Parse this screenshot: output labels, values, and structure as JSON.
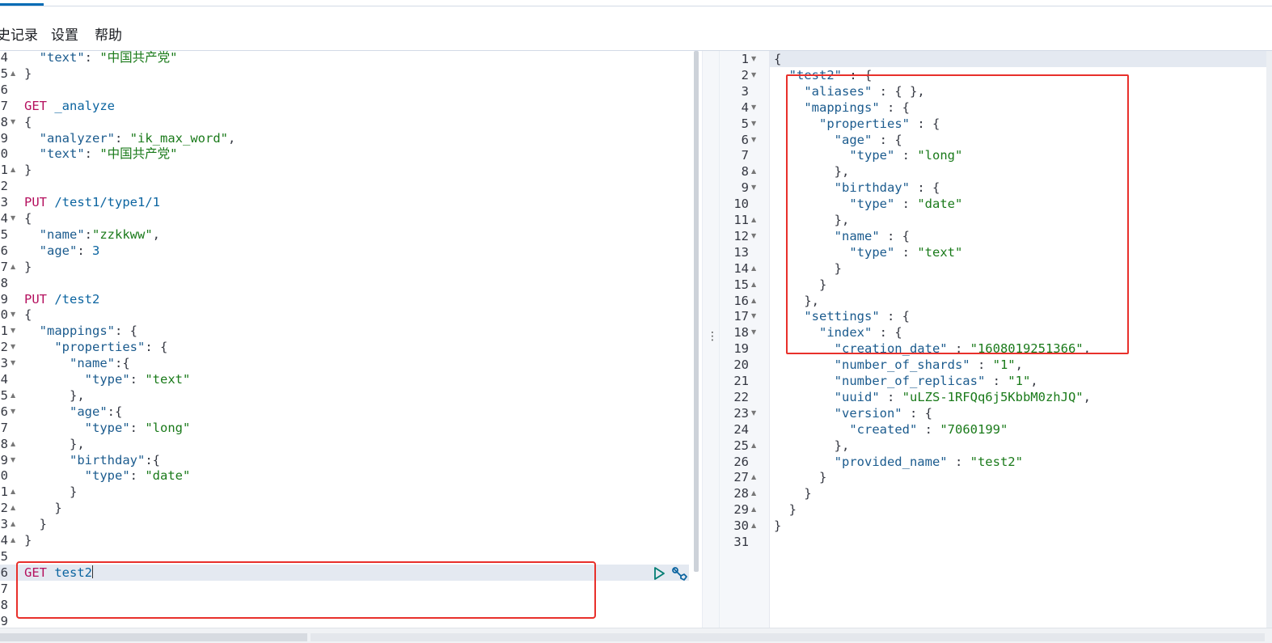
{
  "menu": {
    "items": [
      "史记录",
      "设置",
      "帮助"
    ]
  },
  "colors": {
    "method": "#b5115f",
    "string": "#1a7a1a",
    "key": "#1b5b8e",
    "highlight_box": "#e8302b"
  },
  "left_editor": {
    "lines": [
      {
        "num": "4",
        "fold": "",
        "parts": [
          [
            "p",
            "  "
          ],
          [
            "k",
            "\"text\""
          ],
          [
            "p",
            ": "
          ],
          [
            "s",
            "\"中国共产党\""
          ]
        ]
      },
      {
        "num": "5",
        "fold": "up",
        "parts": [
          [
            "p",
            "}"
          ]
        ]
      },
      {
        "num": "6",
        "fold": "",
        "parts": []
      },
      {
        "num": "7",
        "fold": "",
        "parts": [
          [
            "m",
            "GET"
          ],
          [
            "p",
            " "
          ],
          [
            "n",
            "_analyze"
          ]
        ]
      },
      {
        "num": "8",
        "fold": "down",
        "parts": [
          [
            "p",
            "{"
          ]
        ]
      },
      {
        "num": "9",
        "fold": "",
        "parts": [
          [
            "p",
            "  "
          ],
          [
            "k",
            "\"analyzer\""
          ],
          [
            "p",
            ": "
          ],
          [
            "s",
            "\"ik_max_word\""
          ],
          [
            "p",
            ","
          ]
        ]
      },
      {
        "num": "0",
        "fold": "",
        "parts": [
          [
            "p",
            "  "
          ],
          [
            "k",
            "\"text\""
          ],
          [
            "p",
            ": "
          ],
          [
            "s",
            "\"中国共产党\""
          ]
        ]
      },
      {
        "num": "1",
        "fold": "up",
        "parts": [
          [
            "p",
            "}"
          ]
        ]
      },
      {
        "num": "2",
        "fold": "",
        "parts": []
      },
      {
        "num": "3",
        "fold": "",
        "parts": [
          [
            "m",
            "PUT"
          ],
          [
            "p",
            " "
          ],
          [
            "n",
            "/test1/type1/1"
          ]
        ]
      },
      {
        "num": "4",
        "fold": "down",
        "parts": [
          [
            "p",
            "{"
          ]
        ]
      },
      {
        "num": "5",
        "fold": "",
        "parts": [
          [
            "p",
            "  "
          ],
          [
            "k",
            "\"name\""
          ],
          [
            "p",
            ":"
          ],
          [
            "s",
            "\"zzkkww\""
          ],
          [
            "p",
            ","
          ]
        ]
      },
      {
        "num": "6",
        "fold": "",
        "parts": [
          [
            "p",
            "  "
          ],
          [
            "k",
            "\"age\""
          ],
          [
            "p",
            ": "
          ],
          [
            "n",
            "3"
          ]
        ]
      },
      {
        "num": "7",
        "fold": "up",
        "parts": [
          [
            "p",
            "}"
          ]
        ]
      },
      {
        "num": "8",
        "fold": "",
        "parts": []
      },
      {
        "num": "9",
        "fold": "",
        "parts": [
          [
            "m",
            "PUT"
          ],
          [
            "p",
            " "
          ],
          [
            "n",
            "/test2"
          ]
        ]
      },
      {
        "num": "0",
        "fold": "down",
        "parts": [
          [
            "p",
            "{"
          ]
        ]
      },
      {
        "num": "1",
        "fold": "down",
        "parts": [
          [
            "p",
            "  "
          ],
          [
            "k",
            "\"mappings\""
          ],
          [
            "p",
            ": {"
          ]
        ]
      },
      {
        "num": "2",
        "fold": "down",
        "parts": [
          [
            "p",
            "    "
          ],
          [
            "k",
            "\"properties\""
          ],
          [
            "p",
            ": {"
          ]
        ]
      },
      {
        "num": "3",
        "fold": "down",
        "parts": [
          [
            "p",
            "      "
          ],
          [
            "k",
            "\"name\""
          ],
          [
            "p",
            ":{"
          ]
        ]
      },
      {
        "num": "4",
        "fold": "",
        "parts": [
          [
            "p",
            "        "
          ],
          [
            "k",
            "\"type\""
          ],
          [
            "p",
            ": "
          ],
          [
            "s",
            "\"text\""
          ]
        ]
      },
      {
        "num": "5",
        "fold": "up",
        "parts": [
          [
            "p",
            "      },"
          ]
        ]
      },
      {
        "num": "6",
        "fold": "down",
        "parts": [
          [
            "p",
            "      "
          ],
          [
            "k",
            "\"age\""
          ],
          [
            "p",
            ":{"
          ]
        ]
      },
      {
        "num": "7",
        "fold": "",
        "parts": [
          [
            "p",
            "        "
          ],
          [
            "k",
            "\"type\""
          ],
          [
            "p",
            ": "
          ],
          [
            "s",
            "\"long\""
          ]
        ]
      },
      {
        "num": "8",
        "fold": "up",
        "parts": [
          [
            "p",
            "      },"
          ]
        ]
      },
      {
        "num": "9",
        "fold": "down",
        "parts": [
          [
            "p",
            "      "
          ],
          [
            "k",
            "\"birthday\""
          ],
          [
            "p",
            ":{"
          ]
        ]
      },
      {
        "num": "0",
        "fold": "",
        "parts": [
          [
            "p",
            "        "
          ],
          [
            "k",
            "\"type\""
          ],
          [
            "p",
            ": "
          ],
          [
            "s",
            "\"date\""
          ]
        ]
      },
      {
        "num": "1",
        "fold": "up",
        "parts": [
          [
            "p",
            "      }"
          ]
        ]
      },
      {
        "num": "2",
        "fold": "up",
        "parts": [
          [
            "p",
            "    }"
          ]
        ]
      },
      {
        "num": "3",
        "fold": "up",
        "parts": [
          [
            "p",
            "  }"
          ]
        ]
      },
      {
        "num": "4",
        "fold": "up",
        "parts": [
          [
            "p",
            "}"
          ]
        ]
      },
      {
        "num": "5",
        "fold": "",
        "parts": []
      },
      {
        "num": "6",
        "fold": "",
        "parts": [
          [
            "m",
            "GET"
          ],
          [
            "p",
            " "
          ],
          [
            "n",
            "test2"
          ]
        ],
        "active": true
      },
      {
        "num": "7",
        "fold": "",
        "parts": []
      },
      {
        "num": "8",
        "fold": "",
        "parts": []
      },
      {
        "num": "9",
        "fold": "",
        "parts": []
      }
    ]
  },
  "right_output": {
    "lines": [
      {
        "num": "1",
        "fold": "down",
        "parts": [
          [
            "p",
            "{"
          ]
        ],
        "active": true
      },
      {
        "num": "2",
        "fold": "down",
        "parts": [
          [
            "p",
            "  "
          ],
          [
            "k",
            "\"test2\""
          ],
          [
            "p",
            " : {"
          ]
        ]
      },
      {
        "num": "3",
        "fold": "",
        "parts": [
          [
            "p",
            "    "
          ],
          [
            "k",
            "\"aliases\""
          ],
          [
            "p",
            " : { },"
          ]
        ]
      },
      {
        "num": "4",
        "fold": "down",
        "parts": [
          [
            "p",
            "    "
          ],
          [
            "k",
            "\"mappings\""
          ],
          [
            "p",
            " : {"
          ]
        ]
      },
      {
        "num": "5",
        "fold": "down",
        "parts": [
          [
            "p",
            "      "
          ],
          [
            "k",
            "\"properties\""
          ],
          [
            "p",
            " : {"
          ]
        ]
      },
      {
        "num": "6",
        "fold": "down",
        "parts": [
          [
            "p",
            "        "
          ],
          [
            "k",
            "\"age\""
          ],
          [
            "p",
            " : {"
          ]
        ]
      },
      {
        "num": "7",
        "fold": "",
        "parts": [
          [
            "p",
            "          "
          ],
          [
            "k",
            "\"type\""
          ],
          [
            "p",
            " : "
          ],
          [
            "s",
            "\"long\""
          ]
        ]
      },
      {
        "num": "8",
        "fold": "up",
        "parts": [
          [
            "p",
            "        },"
          ]
        ]
      },
      {
        "num": "9",
        "fold": "down",
        "parts": [
          [
            "p",
            "        "
          ],
          [
            "k",
            "\"birthday\""
          ],
          [
            "p",
            " : {"
          ]
        ]
      },
      {
        "num": "10",
        "fold": "",
        "parts": [
          [
            "p",
            "          "
          ],
          [
            "k",
            "\"type\""
          ],
          [
            "p",
            " : "
          ],
          [
            "s",
            "\"date\""
          ]
        ]
      },
      {
        "num": "11",
        "fold": "up",
        "parts": [
          [
            "p",
            "        },"
          ]
        ]
      },
      {
        "num": "12",
        "fold": "down",
        "parts": [
          [
            "p",
            "        "
          ],
          [
            "k",
            "\"name\""
          ],
          [
            "p",
            " : {"
          ]
        ]
      },
      {
        "num": "13",
        "fold": "",
        "parts": [
          [
            "p",
            "          "
          ],
          [
            "k",
            "\"type\""
          ],
          [
            "p",
            " : "
          ],
          [
            "s",
            "\"text\""
          ]
        ]
      },
      {
        "num": "14",
        "fold": "up",
        "parts": [
          [
            "p",
            "        }"
          ]
        ]
      },
      {
        "num": "15",
        "fold": "up",
        "parts": [
          [
            "p",
            "      }"
          ]
        ]
      },
      {
        "num": "16",
        "fold": "up",
        "parts": [
          [
            "p",
            "    },"
          ]
        ]
      },
      {
        "num": "17",
        "fold": "down",
        "parts": [
          [
            "p",
            "    "
          ],
          [
            "k",
            "\"settings\""
          ],
          [
            "p",
            " : {"
          ]
        ]
      },
      {
        "num": "18",
        "fold": "down",
        "parts": [
          [
            "p",
            "      "
          ],
          [
            "k",
            "\"index\""
          ],
          [
            "p",
            " : {"
          ]
        ]
      },
      {
        "num": "19",
        "fold": "",
        "parts": [
          [
            "p",
            "        "
          ],
          [
            "k",
            "\"creation_date\""
          ],
          [
            "p",
            " : "
          ],
          [
            "s",
            "\"1608019251366\""
          ],
          [
            "p",
            ","
          ]
        ]
      },
      {
        "num": "20",
        "fold": "",
        "parts": [
          [
            "p",
            "        "
          ],
          [
            "k",
            "\"number_of_shards\""
          ],
          [
            "p",
            " : "
          ],
          [
            "s",
            "\"1\""
          ],
          [
            "p",
            ","
          ]
        ]
      },
      {
        "num": "21",
        "fold": "",
        "parts": [
          [
            "p",
            "        "
          ],
          [
            "k",
            "\"number_of_replicas\""
          ],
          [
            "p",
            " : "
          ],
          [
            "s",
            "\"1\""
          ],
          [
            "p",
            ","
          ]
        ]
      },
      {
        "num": "22",
        "fold": "",
        "parts": [
          [
            "p",
            "        "
          ],
          [
            "k",
            "\"uuid\""
          ],
          [
            "p",
            " : "
          ],
          [
            "s",
            "\"uLZS-1RFQq6j5KbbM0zhJQ\""
          ],
          [
            "p",
            ","
          ]
        ]
      },
      {
        "num": "23",
        "fold": "down",
        "parts": [
          [
            "p",
            "        "
          ],
          [
            "k",
            "\"version\""
          ],
          [
            "p",
            " : {"
          ]
        ]
      },
      {
        "num": "24",
        "fold": "",
        "parts": [
          [
            "p",
            "          "
          ],
          [
            "k",
            "\"created\""
          ],
          [
            "p",
            " : "
          ],
          [
            "s",
            "\"7060199\""
          ]
        ]
      },
      {
        "num": "25",
        "fold": "up",
        "parts": [
          [
            "p",
            "        },"
          ]
        ]
      },
      {
        "num": "26",
        "fold": "",
        "parts": [
          [
            "p",
            "        "
          ],
          [
            "k",
            "\"provided_name\""
          ],
          [
            "p",
            " : "
          ],
          [
            "s",
            "\"test2\""
          ]
        ]
      },
      {
        "num": "27",
        "fold": "up",
        "parts": [
          [
            "p",
            "      }"
          ]
        ]
      },
      {
        "num": "28",
        "fold": "up",
        "parts": [
          [
            "p",
            "    }"
          ]
        ]
      },
      {
        "num": "29",
        "fold": "up",
        "parts": [
          [
            "p",
            "  }"
          ]
        ]
      },
      {
        "num": "30",
        "fold": "up",
        "parts": [
          [
            "p",
            "}"
          ]
        ]
      },
      {
        "num": "31",
        "fold": "",
        "parts": []
      }
    ]
  },
  "icons": {
    "run": "play-icon",
    "settings": "wrench-icon",
    "resize": "vertical-dots-icon"
  }
}
